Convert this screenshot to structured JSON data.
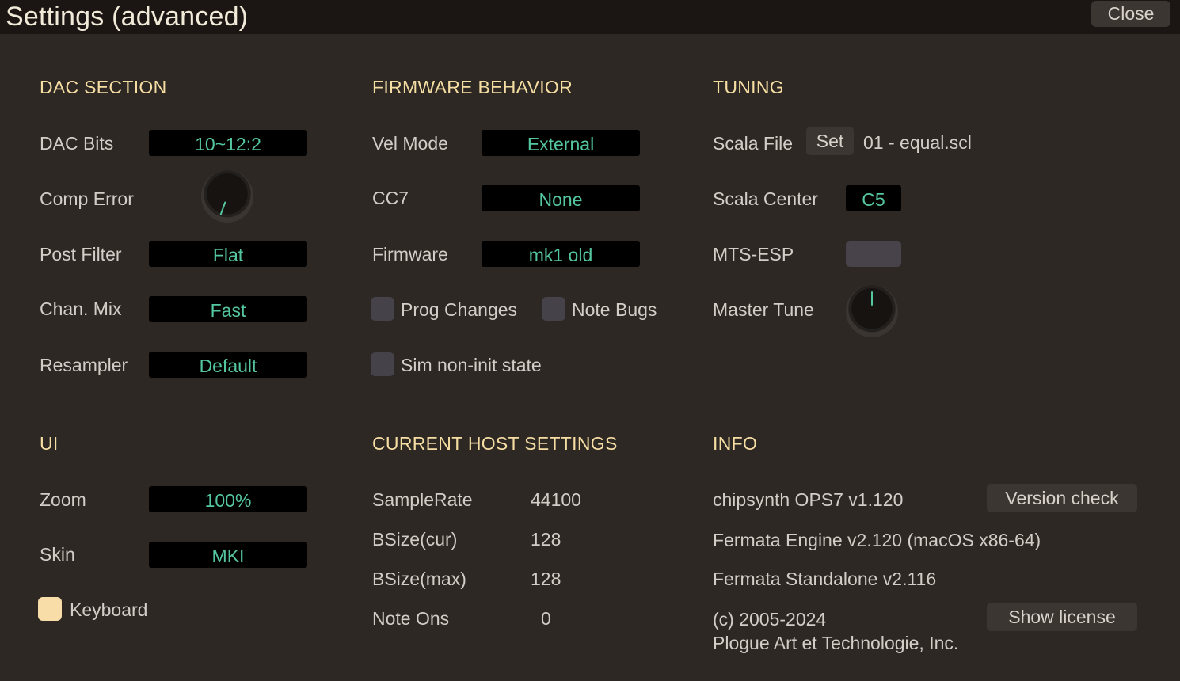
{
  "window": {
    "title": "Settings (advanced)",
    "close_label": "Close"
  },
  "dac": {
    "header": "DAC SECTION",
    "dac_bits_label": "DAC Bits",
    "dac_bits_value": "10~12:2",
    "comp_error_label": "Comp Error",
    "post_filter_label": "Post Filter",
    "post_filter_value": "Flat",
    "chan_mix_label": "Chan. Mix",
    "chan_mix_value": "Fast",
    "resampler_label": "Resampler",
    "resampler_value": "Default"
  },
  "firmware": {
    "header": "FIRMWARE BEHAVIOR",
    "vel_mode_label": "Vel Mode",
    "vel_mode_value": "External",
    "cc7_label": "CC7",
    "cc7_value": "None",
    "firmware_label": "Firmware",
    "firmware_value": "mk1 old",
    "prog_changes_label": "Prog Changes",
    "note_bugs_label": "Note Bugs",
    "sim_label": "Sim non-init state"
  },
  "tuning": {
    "header": "TUNING",
    "scala_file_label": "Scala File",
    "set_label": "Set",
    "scala_file_value": "01 - equal.scl",
    "scala_center_label": "Scala Center",
    "scala_center_value": "C5",
    "mts_label": "MTS-ESP",
    "master_tune_label": "Master Tune"
  },
  "ui": {
    "header": "UI",
    "zoom_label": "Zoom",
    "zoom_value": "100%",
    "skin_label": "Skin",
    "skin_value": "MKI",
    "keyboard_label": "Keyboard"
  },
  "host": {
    "header": "CURRENT HOST SETTINGS",
    "rows": [
      {
        "label": "SampleRate",
        "value": "44100"
      },
      {
        "label": "BSize(cur)",
        "value": "128"
      },
      {
        "label": "BSize(max)",
        "value": "128"
      },
      {
        "label": "Note Ons",
        "value": "0"
      }
    ]
  },
  "info": {
    "header": "INFO",
    "product": "chipsynth OPS7 v1.120",
    "version_check_label": "Version check",
    "engine": "Fermata Engine v2.120 (macOS x86-64)",
    "standalone": "Fermata Standalone v2.116",
    "copyright": "(c) 2005-2024",
    "company": "Plogue Art et Technologie, Inc.",
    "show_license_label": "Show license"
  },
  "icons": {
    "knob": "knob-icon"
  },
  "colors": {
    "accent": "#55c7a0",
    "header": "#f6dea3",
    "background": "#2d2824"
  }
}
